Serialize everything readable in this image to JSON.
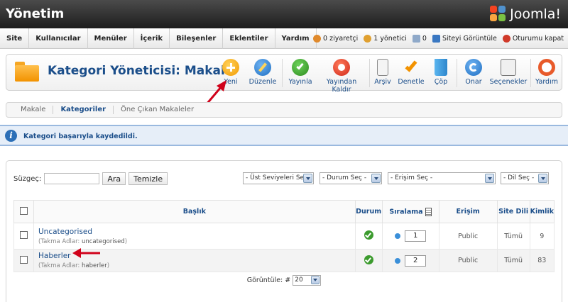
{
  "header": {
    "title": "Yönetim",
    "logo_text": "Joomla!"
  },
  "menu": {
    "items": [
      "Site",
      "Kullanıcılar",
      "Menüler",
      "İçerik",
      "Bileşenler",
      "Eklentiler",
      "Yardım"
    ],
    "status": {
      "visitors": "0 ziyaretçi",
      "admins": "1 yönetici",
      "messages": "0",
      "view_site": "Siteyi Görüntüle",
      "logout": "Oturumu kapat"
    }
  },
  "toolbar": {
    "title": "Kategori Yöneticisi: Makale",
    "buttons": {
      "new": "Yeni",
      "edit": "Düzenle",
      "publish": "Yayınla",
      "unpublish": "Yayından Kaldır",
      "archive": "Arşiv",
      "checkin": "Denetle",
      "trash": "Çöp",
      "rebuild": "Onar",
      "options": "Seçenekler",
      "help": "Yardım"
    }
  },
  "submenu": {
    "items": [
      "Makale",
      "Kategoriler",
      "Öne Çıkan Makaleler"
    ],
    "active": "Kategoriler"
  },
  "message": {
    "text": "Kategori başarıyla kaydedildi."
  },
  "filters": {
    "label": "Süzgeç:",
    "search_value": "",
    "search_button": "Ara",
    "clear_button": "Temizle",
    "select_level": "- Üst Seviyeleri Seç -",
    "select_state": "- Durum Seç -",
    "select_access": "- Erişim Seç -",
    "select_language": "- Dil Seç -"
  },
  "table": {
    "headers": {
      "title": "Başlık",
      "status": "Durum",
      "ordering": "Sıralama",
      "access": "Erişim",
      "language": "Site Dili",
      "id": "Kimlik"
    },
    "alias_label": "Takma Adlar:",
    "rows": [
      {
        "title": "Uncategorised",
        "alias": "uncategorised",
        "order": "1",
        "access": "Public",
        "language": "Tümü",
        "id": "9"
      },
      {
        "title": "Haberler",
        "alias": "haberler",
        "order": "2",
        "access": "Public",
        "language": "Tümü",
        "id": "83"
      }
    ]
  },
  "pagination": {
    "label": "Görüntüle: #",
    "limit": "20"
  },
  "colors": {
    "accent": "#1b4e8a",
    "annotation_arrow": "#d0021b",
    "published": "#3c9b2e"
  }
}
